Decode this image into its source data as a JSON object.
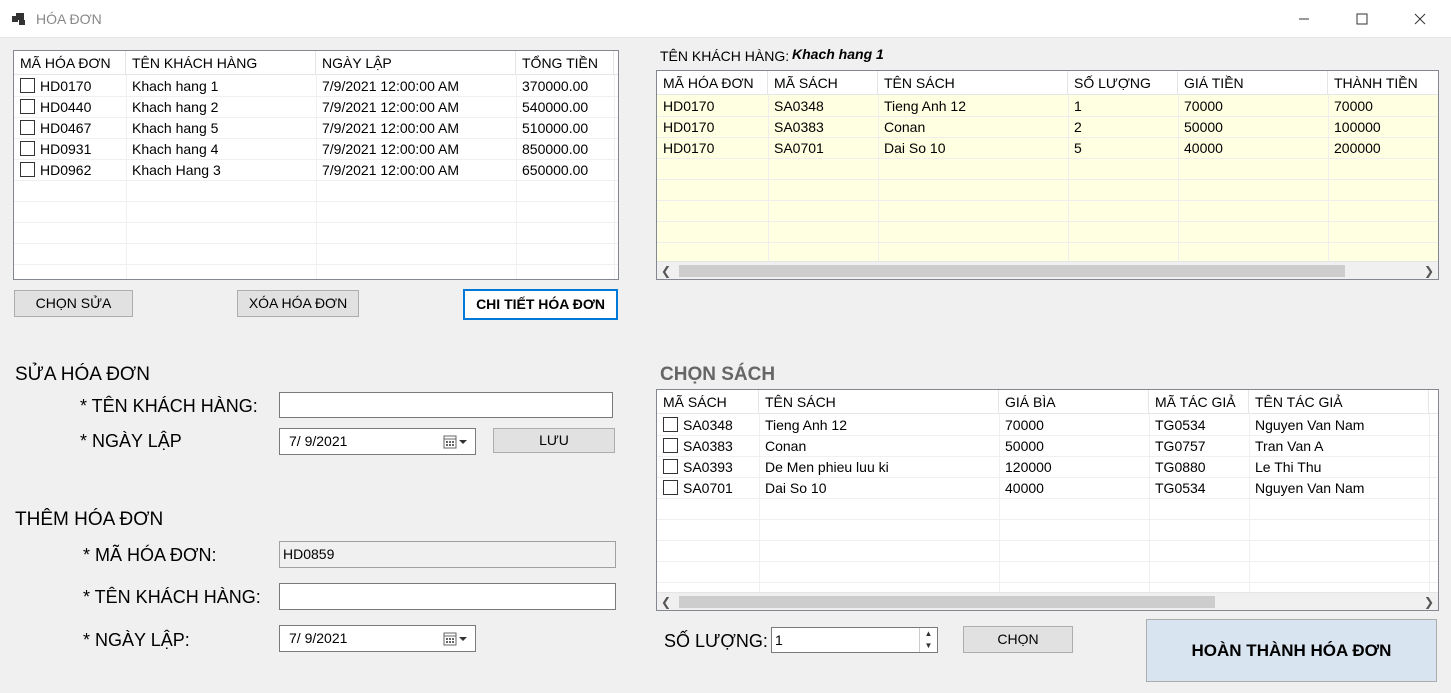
{
  "window": {
    "title": "HÓA ĐƠN"
  },
  "invoices": {
    "columns": [
      "MÃ HÓA ĐƠN",
      "TÊN KHÁCH HÀNG",
      "NGÀY LẬP",
      "TỔNG TIỀN"
    ],
    "rows": [
      [
        "HD0170",
        "Khach hang 1",
        "7/9/2021 12:00:00 AM",
        "370000.00"
      ],
      [
        "HD0440",
        "Khach hang 2",
        "7/9/2021 12:00:00 AM",
        "540000.00"
      ],
      [
        "HD0467",
        "Khach hang 5",
        "7/9/2021 12:00:00 AM",
        "510000.00"
      ],
      [
        "HD0931",
        "Khach hang 4",
        "7/9/2021 12:00:00 AM",
        "850000.00"
      ],
      [
        "HD0962",
        "Khach Hang 3",
        "7/9/2021 12:00:00 AM",
        "650000.00"
      ]
    ]
  },
  "buttons": {
    "edit": "CHỌN SỬA",
    "delete": "XÓA HÓA ĐƠN",
    "detail": "CHI TIẾT HÓA ĐƠN",
    "save": "LƯU",
    "choose": "CHỌN",
    "complete": "HOÀN THÀNH HÓA ĐƠN"
  },
  "detail": {
    "customer_label": "TÊN KHÁCH HÀNG:",
    "customer_value": "Khach hang 1",
    "columns": [
      "MÃ HÓA ĐƠN",
      "MÃ SÁCH",
      "TÊN SÁCH",
      "SỐ LƯỢNG",
      "GIÁ TIỀN",
      "THÀNH TIỀN"
    ],
    "rows": [
      [
        "HD0170",
        "SA0348",
        "Tieng Anh 12",
        "1",
        "70000",
        "70000"
      ],
      [
        "HD0170",
        "SA0383",
        "Conan",
        "2",
        "50000",
        "100000"
      ],
      [
        "HD0170",
        "SA0701",
        "Dai So 10",
        "5",
        "40000",
        "200000"
      ]
    ]
  },
  "edit_form": {
    "title": "SỬA HÓA ĐƠN",
    "customer_label": "* TÊN KHÁCH HÀNG:",
    "customer_value": "",
    "date_label": "* NGÀY LẬP",
    "date_value": "7/  9/2021"
  },
  "add_form": {
    "title": "THÊM HÓA ĐƠN",
    "id_label": "* MÃ HÓA ĐƠN:",
    "id_value": "HD0859",
    "customer_label": "* TÊN KHÁCH HÀNG:",
    "customer_value": "",
    "date_label": "* NGÀY LẬP:",
    "date_value": "7/  9/2021"
  },
  "books": {
    "title": "CHỌN SÁCH",
    "columns": [
      "MÃ SÁCH",
      "TÊN SÁCH",
      "GIÁ BÌA",
      "MÃ TÁC GIẢ",
      "TÊN TÁC GIẢ"
    ],
    "rows": [
      [
        "SA0348",
        "Tieng Anh 12",
        "70000",
        "TG0534",
        "Nguyen Van Nam"
      ],
      [
        "SA0383",
        "Conan",
        "50000",
        "TG0757",
        "Tran Van A"
      ],
      [
        "SA0393",
        "De Men phieu luu ki",
        "120000",
        "TG0880",
        "Le Thi Thu"
      ],
      [
        "SA0701",
        "Dai So 10",
        "40000",
        "TG0534",
        "Nguyen Van Nam"
      ]
    ]
  },
  "quantity": {
    "label": "SỐ LƯỢNG:",
    "value": "1"
  },
  "colors": {
    "accent": "#0078d7",
    "detail_bg": "#ffffe1",
    "complete_bg": "#d9e4f1"
  }
}
